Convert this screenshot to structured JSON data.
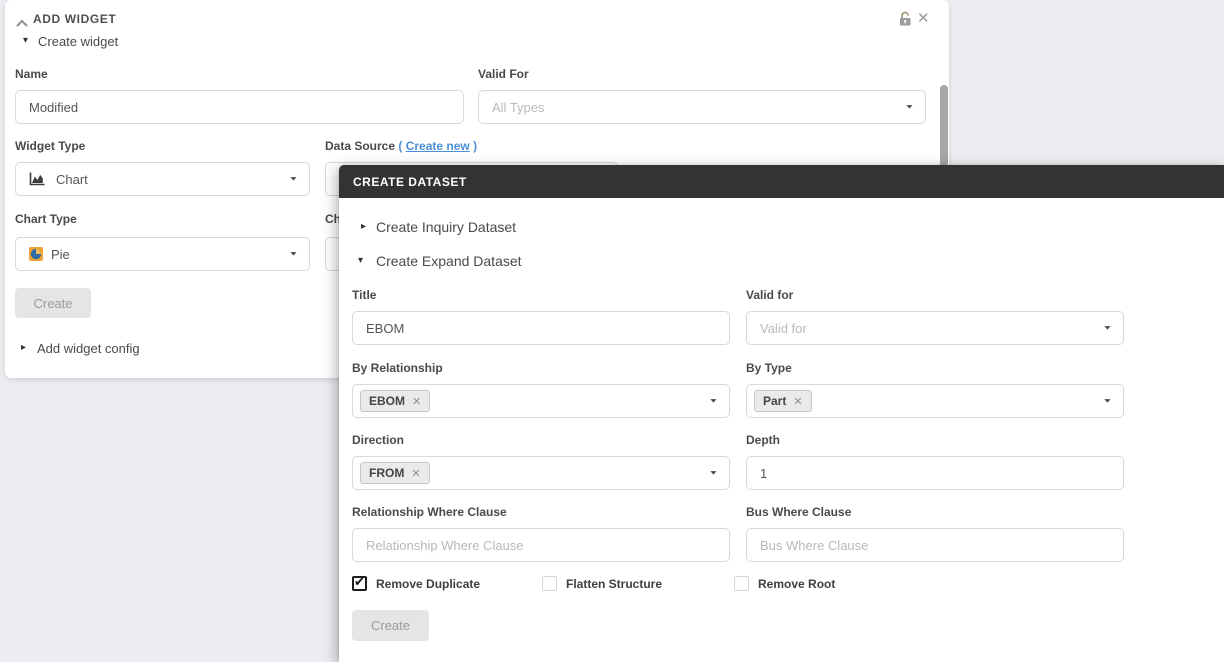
{
  "colors": {
    "page_bg": "#ebedf0",
    "modal_header_bg": "#333333",
    "link_blue": "#4a90d9",
    "pie_icon_orange": "#f0a232",
    "pie_icon_blue": "#2e6da4",
    "chip_bg": "#e9eaeb"
  },
  "icons": {
    "caret": "▼",
    "triangle_right": "▸",
    "triangle_down": "▾",
    "close": "✕",
    "chip_remove": "✕"
  },
  "add_widget": {
    "title": "ADD WIDGET",
    "section": "Create widget",
    "name_label": "Name",
    "name_value": "Modified",
    "valid_for_label": "Valid For",
    "valid_for_placeholder": "All Types",
    "widget_type_label": "Widget Type",
    "widget_type_value": "Chart",
    "data_source_label": "Data Source",
    "data_source_paren_open": "(",
    "data_source_link": "Create new",
    "data_source_paren_close": ")",
    "chart_type_label": "Chart Type",
    "chart_type_value": "Pie",
    "col2_partial_label": "Ch",
    "create_button": "Create",
    "config_toggle": "Add widget config"
  },
  "modal": {
    "title": "CREATE DATASET",
    "inquiry_item": "Create Inquiry Dataset",
    "expand_item": "Create Expand Dataset",
    "title_label": "Title",
    "title_value": "EBOM",
    "valid_for_label": "Valid for",
    "valid_for_placeholder": "Valid for",
    "by_relationship_label": "By Relationship",
    "by_relationship_chip": "EBOM",
    "by_type_label": "By Type",
    "by_type_chip": "Part",
    "direction_label": "Direction",
    "direction_chip": "FROM",
    "depth_label": "Depth",
    "depth_value": "1",
    "rel_where_label": "Relationship Where Clause",
    "rel_where_placeholder": "Relationship Where Clause",
    "bus_where_label": "Bus Where Clause",
    "bus_where_placeholder": "Bus Where Clause",
    "checkboxes": [
      {
        "label": "Remove Duplicate",
        "checked": true
      },
      {
        "label": "Flatten Structure",
        "checked": false
      },
      {
        "label": "Remove Root",
        "checked": false
      }
    ],
    "create_button": "Create"
  }
}
